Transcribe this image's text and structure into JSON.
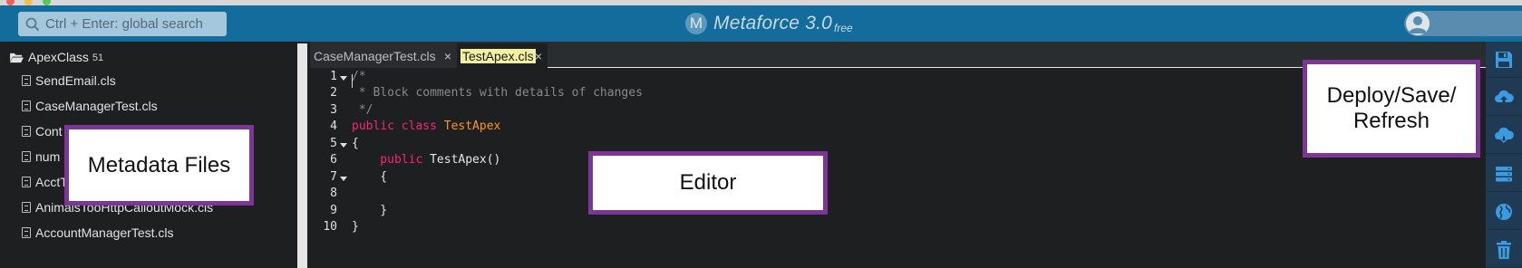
{
  "header": {
    "search_placeholder": "Ctrl + Enter: global search",
    "brand_logo_letter": "M",
    "brand_name": "Metaforce 3.0",
    "brand_tier": "free"
  },
  "sidebar": {
    "root_label": "ApexClass",
    "root_count": "51",
    "files": [
      "SendEmail.cls",
      "CaseManagerTest.cls",
      "Cont",
      "num",
      "AcctT",
      "AnimalsTooHttpCalloutMock.cls",
      "AccountManagerTest.cls"
    ]
  },
  "tabs": [
    {
      "label": "CaseManagerTest.cls",
      "close": "×",
      "active": false
    },
    {
      "label": "TestApex.cls",
      "close": "×",
      "active": true
    }
  ],
  "editor": {
    "line_numbers": [
      "1",
      "2",
      "3",
      "4",
      "5",
      "6",
      "7",
      "8",
      "9",
      "10"
    ],
    "lines": {
      "l1": "/*",
      "l2": " * Block comments with details of changes",
      "l3": " */",
      "l4_kw": "public class ",
      "l4_name": "TestApex",
      "l5": "{",
      "l6_kw": "    public ",
      "l6_rest": "TestApex()",
      "l7": "    {",
      "l8": "",
      "l9": "    }",
      "l10": "}"
    }
  },
  "toolbar": {
    "icons": [
      "save-icon",
      "deploy-icon",
      "refresh-icon",
      "server-icon",
      "globe-icon",
      "trash-icon"
    ]
  },
  "annotations": {
    "metadata": "Metadata Files",
    "editor": "Editor",
    "deploy_line1": "Deploy/Save/",
    "deploy_line2": "Refresh"
  },
  "colors": {
    "header": "#136c9b",
    "editor_bg": "#1d1f21",
    "keyword": "#f92672",
    "class_name": "#fd971f",
    "comment": "#8a8a86",
    "callout_border": "#7b3696",
    "toolbar": "#1f3a52",
    "toolbar_icon": "#3a9be0"
  }
}
